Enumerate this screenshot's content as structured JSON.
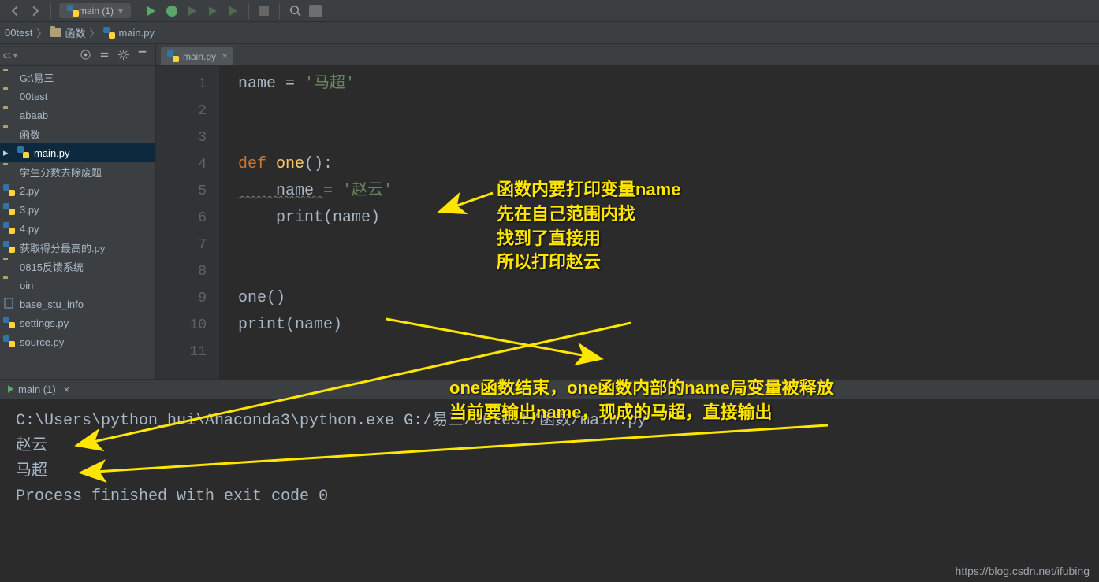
{
  "toolbar": {
    "run_config": "main (1)"
  },
  "breadcrumbs": {
    "item0": "00test",
    "item1": "函数",
    "item2": "main.py"
  },
  "sidebar": {
    "header_title": "ct",
    "items": [
      {
        "type": "root",
        "label": "G:\\易三"
      },
      {
        "type": "folder",
        "label": "00test"
      },
      {
        "type": "folder",
        "label": "abaab"
      },
      {
        "type": "folder",
        "label": "函数"
      },
      {
        "type": "py",
        "label": "main.py",
        "selected": true
      },
      {
        "type": "folder",
        "label": "学生分数去除废题"
      },
      {
        "type": "py",
        "label": "2.py"
      },
      {
        "type": "py",
        "label": "3.py"
      },
      {
        "type": "py",
        "label": "4.py"
      },
      {
        "type": "py",
        "label": "获取得分最高的.py"
      },
      {
        "type": "folder",
        "label": "0815反馈系统"
      },
      {
        "type": "folder",
        "label": "oin"
      },
      {
        "type": "file",
        "label": "base_stu_info"
      },
      {
        "type": "py",
        "label": "settings.py"
      },
      {
        "type": "py",
        "label": "source.py"
      }
    ]
  },
  "editor": {
    "tab0": "main.py",
    "line_numbers": [
      "1",
      "2",
      "3",
      "4",
      "5",
      "6",
      "7",
      "8",
      "9",
      "10",
      "11"
    ],
    "code": {
      "l1_lhs": "name ",
      "l1_eq": "= ",
      "l1_str": "'马超'",
      "l4_def": "def ",
      "l4_name": "one",
      "l4_rest": "():",
      "l5_lhs": "    name ",
      "l5_eq": "= ",
      "l5_str": "'赵云'",
      "l6_call": "    print",
      "l6_arg": "(name)",
      "l9_call": "one()",
      "l10_call": "print",
      "l10_arg": "(name)"
    }
  },
  "annotations": {
    "box1": "函数内要打印变量name\n先在自己范围内找\n找到了直接用\n所以打印赵云",
    "box2": "one函数结束，one函数内部的name局变量被释放\n当前要输出name，现成的马超，直接输出"
  },
  "runbar": {
    "label": "main (1)"
  },
  "console": {
    "line1": "C:\\Users\\python_hui\\Anaconda3\\python.exe G:/易三/00test/函数/main.py",
    "line2": "赵云",
    "line3": "马超",
    "line4": "",
    "line5": "Process finished with exit code 0"
  },
  "watermark": "https://blog.csdn.net/ifubing"
}
